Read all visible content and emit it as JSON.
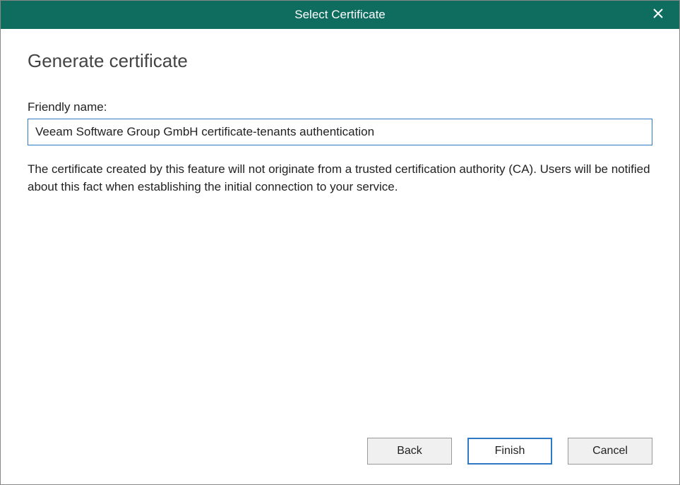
{
  "titlebar": {
    "title": "Select Certificate"
  },
  "page": {
    "heading": "Generate certificate",
    "friendly_name_label": "Friendly name:",
    "friendly_name_value": "Veeam Software Group GmbH certificate-tenants authentication",
    "description": "The certificate created by this feature will not originate from a trusted certification authority (CA). Users will be notified about this fact when establishing the initial connection to your service."
  },
  "buttons": {
    "back": "Back",
    "finish": "Finish",
    "cancel": "Cancel"
  }
}
